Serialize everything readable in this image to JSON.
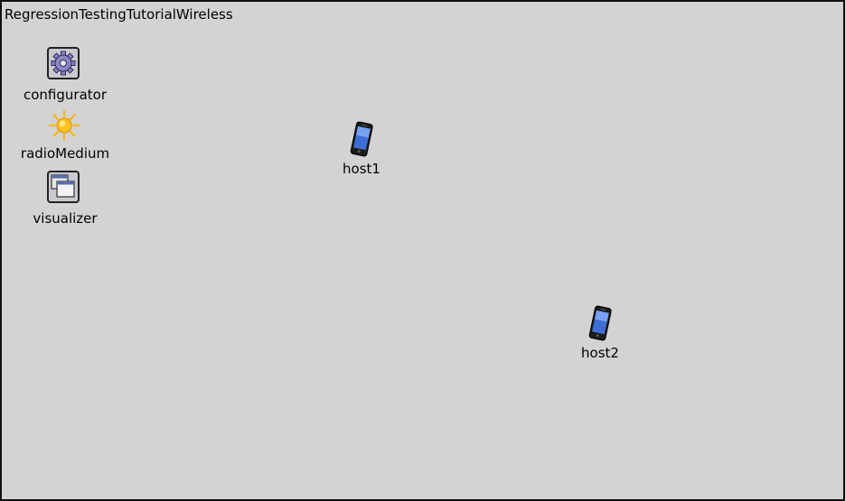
{
  "network": {
    "title": "RegressionTestingTutorialWireless"
  },
  "nodes": {
    "configurator": {
      "label": "configurator",
      "icon": "gear-icon"
    },
    "radioMedium": {
      "label": "radioMedium",
      "icon": "sun-icon"
    },
    "visualizer": {
      "label": "visualizer",
      "icon": "windows-icon"
    },
    "host1": {
      "label": "host1",
      "icon": "phone-icon"
    },
    "host2": {
      "label": "host2",
      "icon": "phone-icon"
    }
  },
  "colors": {
    "canvas_background": "#d3d3d3",
    "border": "#111111",
    "sun": "#f7b500",
    "gear": "#8a86c4"
  }
}
